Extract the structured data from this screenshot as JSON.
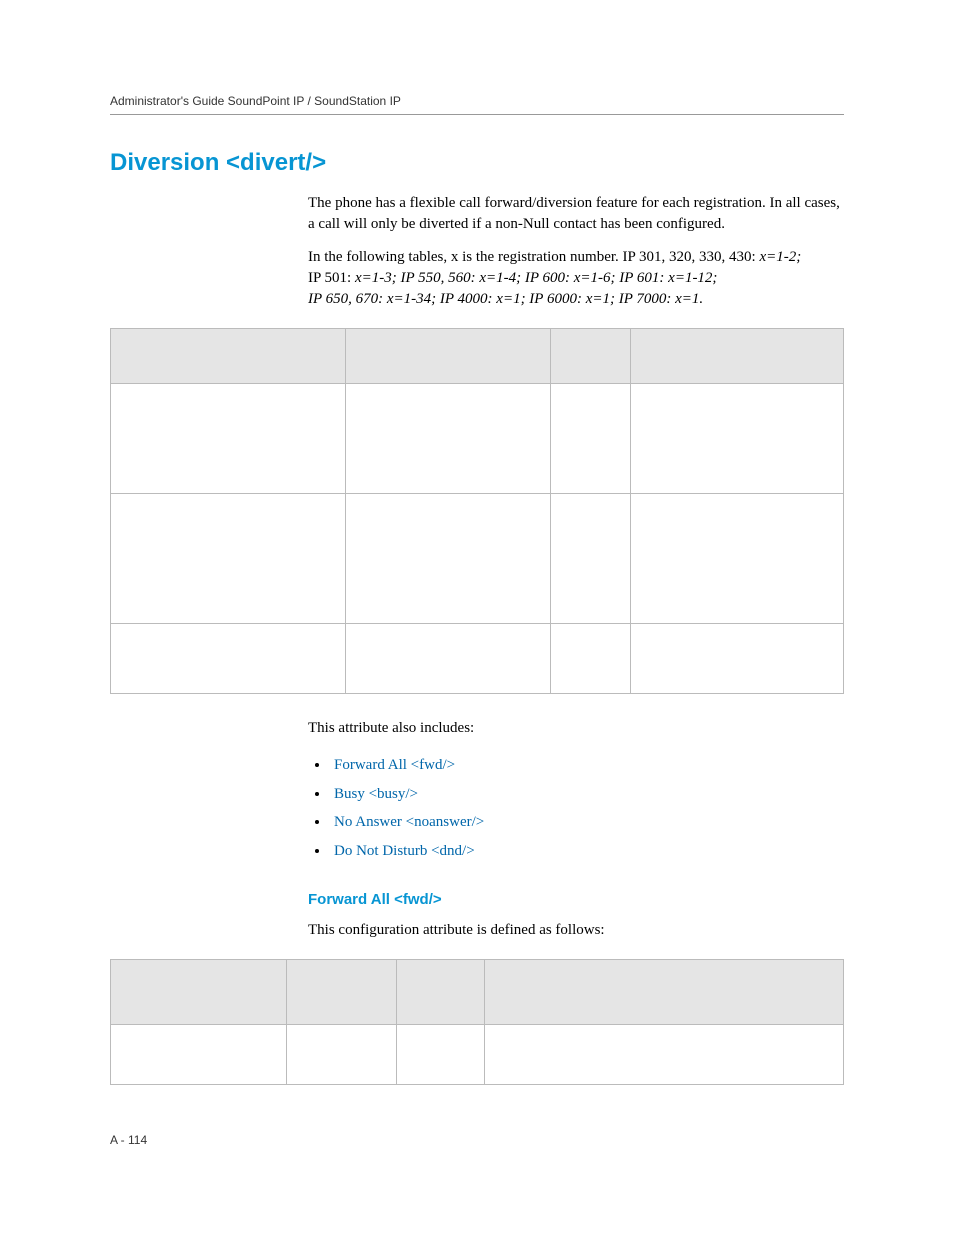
{
  "header": {
    "running": "Administrator's Guide SoundPoint IP / SoundStation IP"
  },
  "section": {
    "title": "Diversion <divert/>",
    "para1": "The phone has a flexible call forward/diversion feature for each registration. In all cases, a call will only be diverted if a non-Null contact has been configured.",
    "para2_prefix": "In the following tables, x is the registration number. IP 301, 320, 330, 430: ",
    "para2_r1": "x=1-2;",
    "para2_l2a": "IP 501: ",
    "para2_l2b": "x=1-3; IP 550, 560: x=1-4; IP 600: x=1-6; IP 601: x=1-12;",
    "para2_l3": "IP 650, 670: x=1-34; IP 4000: x=1; IP 6000: x=1; IP 7000: x=1."
  },
  "table1": {
    "headers": {
      "h1": "",
      "h2": "",
      "h3": "",
      "h4": ""
    },
    "rows": [
      {
        "c1": "",
        "c2": "",
        "c3": "",
        "c4": ""
      },
      {
        "c1": "",
        "c2": "",
        "c3": "",
        "c4": ""
      },
      {
        "c1": "",
        "c2": "",
        "c3": "",
        "c4": ""
      }
    ]
  },
  "also": {
    "intro": "This attribute also includes:",
    "items": [
      "Forward All <fwd/>",
      "Busy <busy/>",
      "No Answer <noanswer/>",
      "Do Not Disturb <dnd/>"
    ]
  },
  "sub": {
    "title": "Forward All <fwd/>",
    "desc": "This configuration attribute is defined as follows:"
  },
  "table2": {
    "headers": {
      "h1": "",
      "h2": "",
      "h3": "",
      "h4": ""
    },
    "rows": [
      {
        "c1": "",
        "c2": "",
        "c3": "",
        "c4": ""
      }
    ]
  },
  "footer": {
    "page": "A - 114"
  }
}
